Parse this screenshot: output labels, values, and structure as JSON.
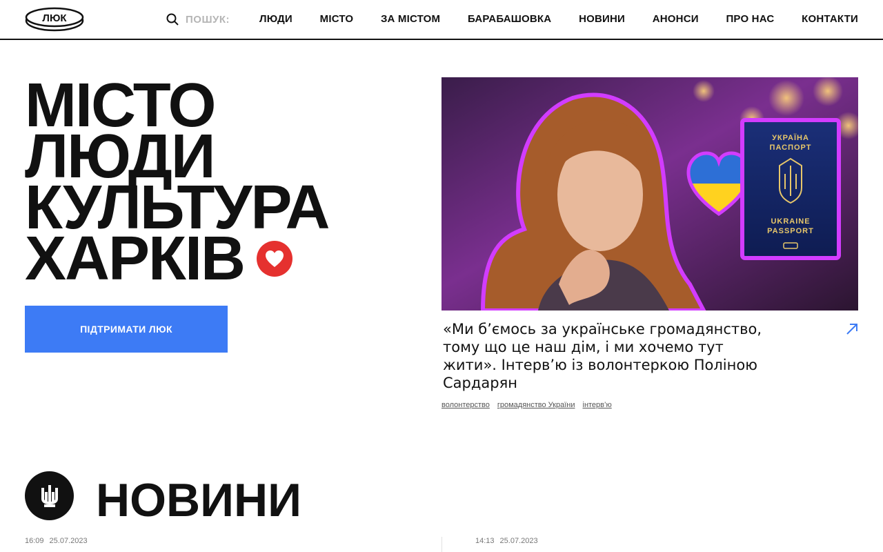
{
  "header": {
    "logo_text": "ЛЮК",
    "search_placeholder": "ПОШУК:",
    "nav": [
      "ЛЮДИ",
      "МІСТО",
      "ЗА МІСТОМ",
      "БАРАБАШОВКА",
      "НОВИНИ",
      "АНОНСИ",
      "ПРО НАС",
      "КОНТАКТИ"
    ]
  },
  "hero": {
    "lines": [
      "МІСТО",
      "ЛЮДИ",
      "КУЛЬТУРА",
      "ХАРКІВ"
    ],
    "support_button": "ПІДТРИМАТИ ЛЮК"
  },
  "featured": {
    "passport_top": [
      "УКРАЇНА",
      "ПАСПОРТ"
    ],
    "passport_bottom": [
      "UKRAINE",
      "PASSPORT"
    ],
    "title": "«Ми б’ємось за українське громадянство, тому що це наш дім, і ми хочемо тут жити». Інтерв’ю із волонтеркою Поліною Сардарян",
    "tags": [
      "волонтерство",
      "громадянство України",
      "інтерв’ю"
    ]
  },
  "news": {
    "title": "НОВИНИ",
    "items": [
      {
        "time": "16:09",
        "date": "25.07.2023"
      },
      {
        "time": "14:13",
        "date": "25.07.2023"
      }
    ]
  },
  "colors": {
    "accent_blue": "#3d7bf5",
    "heart_red": "#e5312f",
    "text": "#111111"
  }
}
